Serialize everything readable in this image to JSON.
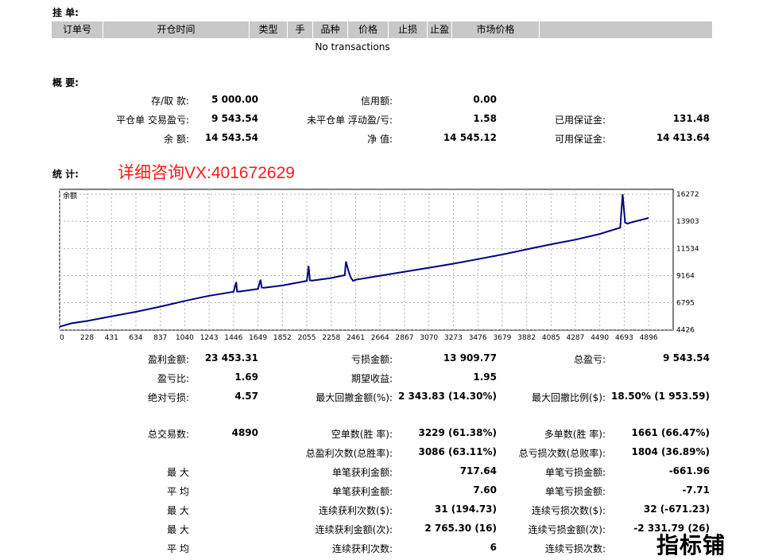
{
  "sections": {
    "orders_title": "挂 单:",
    "summary_title": "概 要:",
    "stats_title": "统 计:"
  },
  "orders_table": {
    "headers": [
      "订单号",
      "开仓时间",
      "类型",
      "手",
      "品种",
      "价格",
      "止损",
      "止盈",
      "市场价格",
      ""
    ],
    "empty_text": "No transactions"
  },
  "summary": [
    {
      "label": "存/取 款:",
      "value": "5 000.00"
    },
    {
      "label": "平仓单 交易盈亏:",
      "value": "9 543.54"
    },
    {
      "label": "余 额:",
      "value": "14 543.54"
    },
    {
      "label": "信用额:",
      "value": "0.00"
    },
    {
      "label": "未平仓单 浮动盈/亏:",
      "value": "1.58"
    },
    {
      "label": "净 值:",
      "value": "14 545.12"
    },
    {
      "label": "已用保证金:",
      "value": "131.48"
    },
    {
      "label": "可用保证金:",
      "value": "14 413.64"
    }
  ],
  "promo_text": "详细咨询VX:401672629",
  "chart_data": {
    "type": "line",
    "title": "余额",
    "x_ticks": [
      0,
      228,
      431,
      634,
      837,
      1040,
      1243,
      1446,
      1649,
      1852,
      2055,
      2258,
      2461,
      2664,
      2867,
      3070,
      3273,
      3476,
      3679,
      3882,
      4085,
      4287,
      4490,
      4693,
      4896
    ],
    "y_ticks": [
      4426,
      6795,
      9164,
      11534,
      13903,
      16272
    ],
    "xlim": [
      0,
      5100
    ],
    "ylim": [
      4400,
      16700
    ],
    "grid": true,
    "series": [
      {
        "color": "#00007f",
        "x": [
          0,
          100,
          228,
          431,
          634,
          837,
          1040,
          1243,
          1446,
          1468,
          1475,
          1490,
          1649,
          1670,
          1680,
          1700,
          1852,
          2055,
          2070,
          2080,
          2100,
          2258,
          2370,
          2380,
          2400,
          2420,
          2440,
          2461,
          2664,
          2867,
          3070,
          3273,
          3476,
          3679,
          3882,
          4085,
          4287,
          4490,
          4660,
          4680,
          4700,
          4720,
          4750,
          4896
        ],
        "y": [
          4700,
          5000,
          5200,
          5600,
          6000,
          6450,
          6950,
          7400,
          7750,
          8600,
          7780,
          7760,
          8000,
          8800,
          8120,
          8100,
          8300,
          8700,
          10000,
          8750,
          8720,
          8950,
          9200,
          10400,
          9600,
          9000,
          8700,
          8800,
          9150,
          9500,
          9850,
          10200,
          10600,
          11000,
          11450,
          11900,
          12300,
          12800,
          13350,
          16272,
          13800,
          13700,
          13800,
          14200
        ]
      }
    ]
  },
  "stats": {
    "col1": [
      {
        "label": "盈利金额:",
        "value": "23 453.31"
      },
      {
        "label": "盈亏比:",
        "value": "1.69"
      },
      {
        "label": "绝对亏损:",
        "value": "4.57"
      },
      {
        "label": "总交易数:",
        "value": "4890"
      },
      {
        "label": "",
        "value": ""
      },
      {
        "label": "最 大",
        "value": ""
      },
      {
        "label": "平 均",
        "value": ""
      },
      {
        "label": "最 大",
        "value": ""
      },
      {
        "label": "最 大",
        "value": ""
      },
      {
        "label": "平 均",
        "value": ""
      }
    ],
    "col2": [
      {
        "label": "亏损金额:",
        "value": "13 909.77"
      },
      {
        "label": "期望收益:",
        "value": "1.95"
      },
      {
        "label": "最大回撤金额(%):",
        "value": "2 343.83 (14.30%)"
      },
      {
        "label": "空单数(胜 率):",
        "value": "3229 (61.38%)"
      },
      {
        "label": "总盈利次数(总胜率):",
        "value": "3086 (63.11%)"
      },
      {
        "label": "单笔获利金额:",
        "value": "717.64"
      },
      {
        "label": "单笔获利金额:",
        "value": "7.60"
      },
      {
        "label": "连续获利次数($):",
        "value": "31 (194.73)"
      },
      {
        "label": "连续获利金额(次):",
        "value": "2 765.30 (16)"
      },
      {
        "label": "连续获利次数:",
        "value": "6"
      }
    ],
    "col3": [
      {
        "label": "总盈亏:",
        "value": "9 543.54"
      },
      {
        "label": "",
        "value": ""
      },
      {
        "label": "最大回撤比例($):",
        "value": "18.50% (1 953.59)"
      },
      {
        "label": "多单数(胜 率):",
        "value": "1661 (66.47%)"
      },
      {
        "label": "总亏损次数(总败率):",
        "value": "1804 (36.89%)"
      },
      {
        "label": "单笔亏损金额:",
        "value": "-661.96"
      },
      {
        "label": "单笔亏损金额:",
        "value": "-7.71"
      },
      {
        "label": "连续亏损次数($):",
        "value": "32 (-671.23)"
      },
      {
        "label": "连续亏损金额(次):",
        "value": "-2 331.79 (26)"
      },
      {
        "label": "连续亏损次数:",
        "value": ""
      }
    ]
  },
  "watermark": "指标铺"
}
